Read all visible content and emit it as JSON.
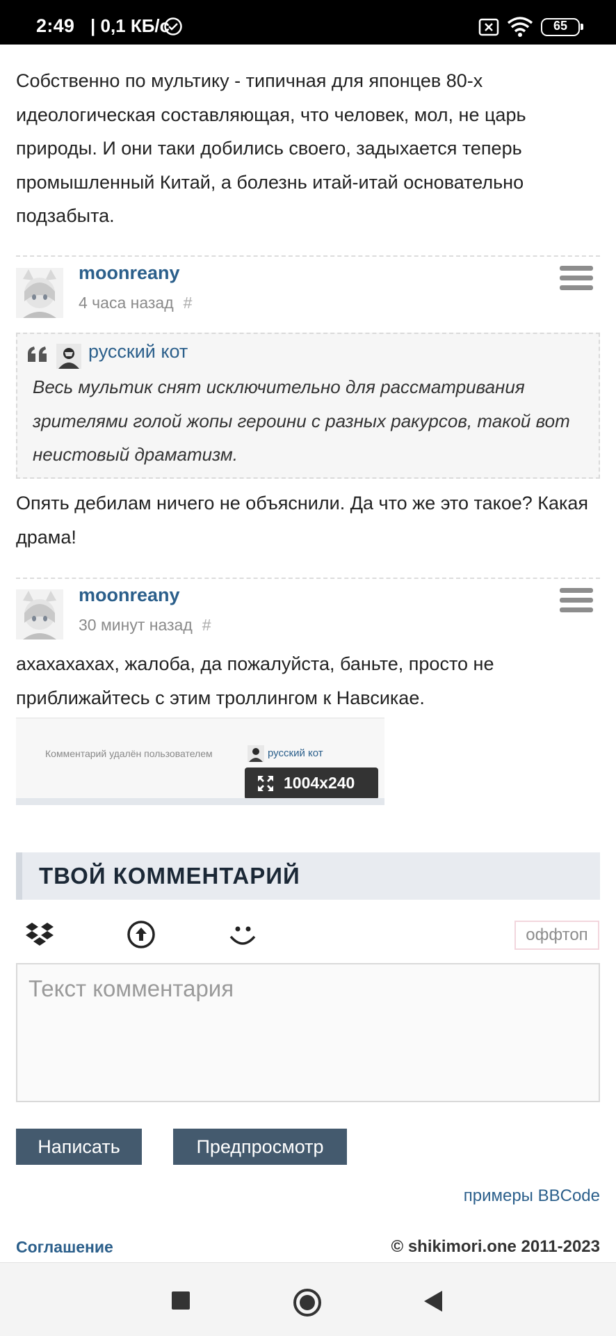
{
  "status_bar": {
    "time": "2:49",
    "speed": "| 0,1 КБ/с",
    "battery": "65",
    "icons": [
      "check-circle-icon",
      "sim-x-icon",
      "wifi-icon",
      "battery-icon"
    ]
  },
  "intro_text": "Собственно по мультику - типичная для японцев 80-х идеологическая составляющая, что человек, мол, не царь природы. И они таки добились своего, задыхается теперь промышленный Китай, а болезнь итай-итай основательно подзабыта.",
  "comments": [
    {
      "user": "moonreany",
      "time": "4 часа назад",
      "hash": "#",
      "quote": {
        "user": "русский кот",
        "text": "Весь мультик снят исключительно для рассматривания зрителями голой жопы героини с разных ракурсов, такой вот неистовый драматизм."
      },
      "body": "Опять дебилам ничего не объяснили. Да что же это такое? Какая драма!"
    },
    {
      "user": "moonreany",
      "time": "30 минут назад",
      "hash": "#",
      "body": "ахахахахах, жалоба, да пожалуйста, баньте, просто не приближайтесь с этим троллингом к Навсикае.",
      "image": {
        "caption": "Комментарий удалён пользователем",
        "user": "русский кот",
        "size": "1004x240"
      }
    }
  ],
  "form": {
    "title": "ТВОЙ КОММЕНТАРИЙ",
    "offtop": "оффтоп",
    "placeholder": "Текст комментария",
    "submit": "Написать",
    "preview": "Предпросмотр",
    "bbcode": "примеры BBCode"
  },
  "footer": {
    "agreement": "Соглашение",
    "copyright": "© shikimori.one 2011-2023"
  },
  "colors": {
    "link": "#2b5f8b",
    "button": "#445a6e",
    "form_title_bg": "#e8ebf0"
  }
}
